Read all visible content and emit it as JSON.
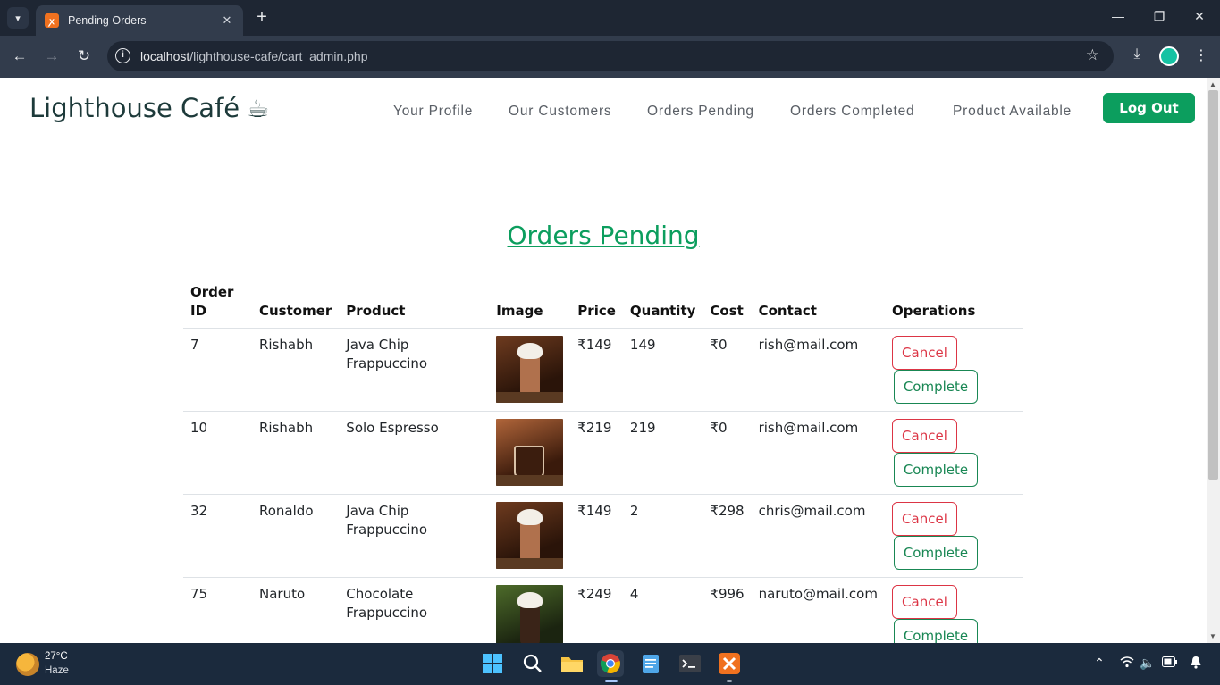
{
  "browser": {
    "tab_title": "Pending Orders",
    "tab_favicon": "xampp-icon",
    "url_host": "localhost",
    "url_path": "/lighthouse-cafe/cart_admin.php"
  },
  "site": {
    "brand": "Lighthouse Café",
    "brand_icon": "☕",
    "nav": [
      "Your Profile",
      "Our Customers",
      "Orders Pending",
      "Orders Completed",
      "Product Available"
    ],
    "logout_label": "Log Out",
    "accent_color": "#0c9e5e"
  },
  "page": {
    "heading": "Orders Pending"
  },
  "orders_table": {
    "headers": [
      "Order ID",
      "Customer",
      "Product",
      "Image",
      "Price",
      "Quantity",
      "Cost",
      "Contact",
      "Operations"
    ],
    "rows": [
      {
        "order_id": "7",
        "customer": "Rishabh",
        "product": "Java Chip Frappuccino",
        "price": "₹149",
        "quantity": "149",
        "cost": "₹0",
        "contact": "rish@mail.com"
      },
      {
        "order_id": "10",
        "customer": "Rishabh",
        "product": "Solo Espresso",
        "price": "₹219",
        "quantity": "219",
        "cost": "₹0",
        "contact": "rish@mail.com"
      },
      {
        "order_id": "32",
        "customer": "Ronaldo",
        "product": "Java Chip Frappuccino",
        "price": "₹149",
        "quantity": "2",
        "cost": "₹298",
        "contact": "chris@mail.com"
      },
      {
        "order_id": "75",
        "customer": "Naruto",
        "product": "Chocolate Frappuccino",
        "price": "₹249",
        "quantity": "4",
        "cost": "₹996",
        "contact": "naruto@mail.com"
      }
    ],
    "cancel_label": "Cancel",
    "complete_label": "Complete"
  },
  "taskbar": {
    "temperature": "27°C",
    "weather": "Haze"
  }
}
